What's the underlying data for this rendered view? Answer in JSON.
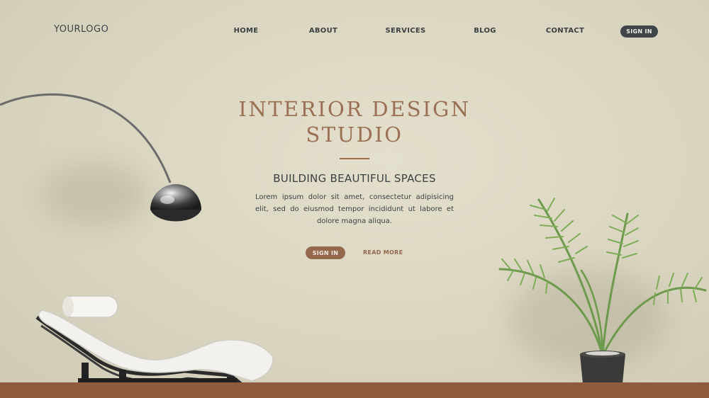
{
  "header": {
    "logo": "YOURLOGO"
  },
  "nav": {
    "items": [
      {
        "label": "HOME"
      },
      {
        "label": "ABOUT"
      },
      {
        "label": "SERVICES"
      },
      {
        "label": "BLOG"
      },
      {
        "label": "CONTACT"
      }
    ],
    "sign_in": "SIGN IN"
  },
  "hero": {
    "title_line1": "INTERIOR DESIGN",
    "title_line2": "STUDIO",
    "subtitle": "BUILDING BEAUTIFUL SPACES",
    "description": "Lorem ipsum dolor sit amet, consectetur adipisicing elit, sed do eiusmod tempor incididunt ut labore et dolore magna aliqua.",
    "primary_button": "SIGN IN",
    "secondary_button": "READ MORE"
  },
  "colors": {
    "background": "#dcd8c3",
    "accent": "#94684d",
    "dark": "#3e4649",
    "floor": "#8f5b3e"
  }
}
